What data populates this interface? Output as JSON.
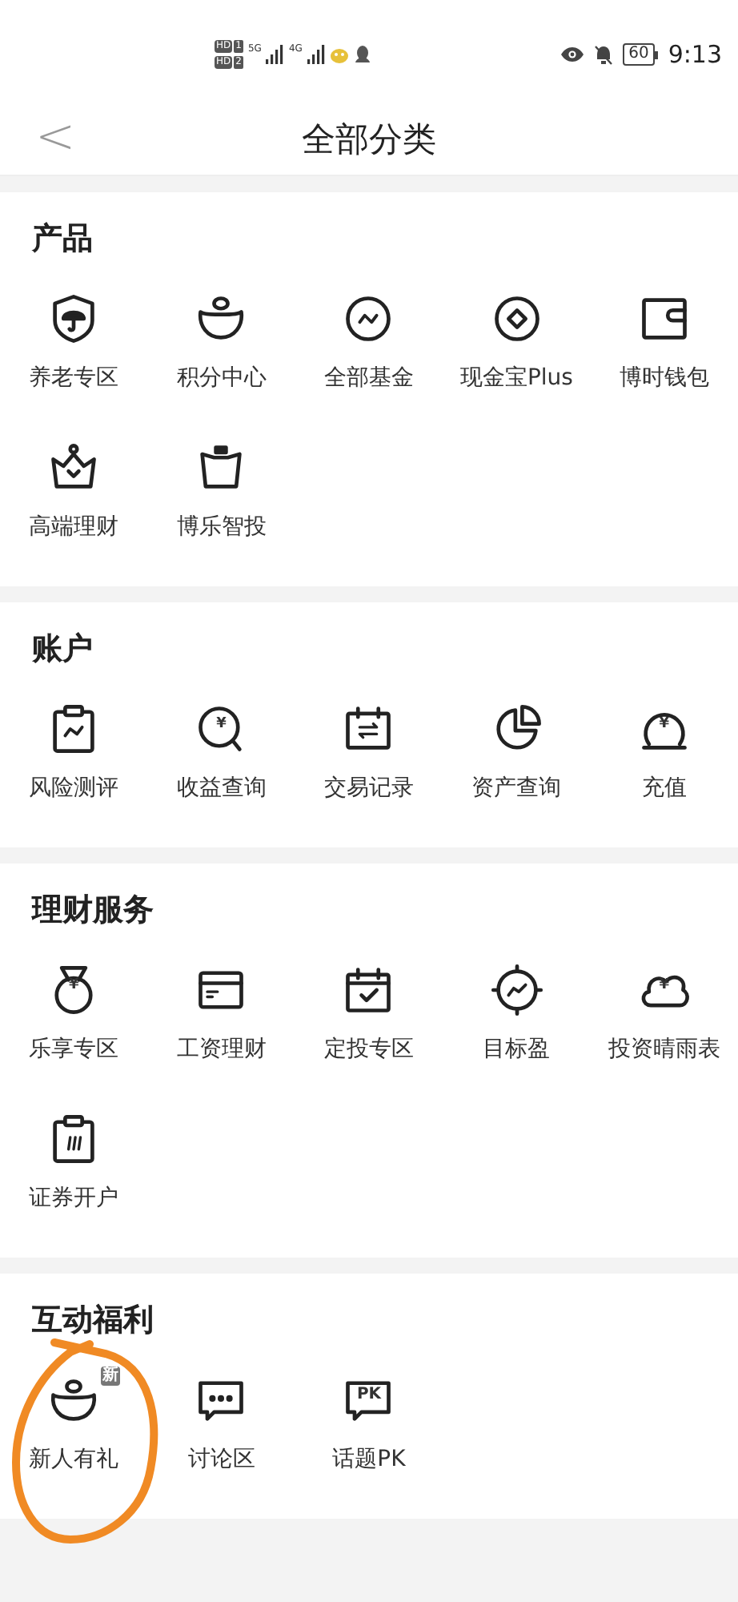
{
  "status_bar": {
    "sims": [
      {
        "badge": "HD",
        "slot": "1"
      },
      {
        "badge": "HD",
        "slot": "2"
      }
    ],
    "networks": [
      "5G",
      "4G"
    ],
    "battery": "60",
    "time": "9:13"
  },
  "header": {
    "back": "<",
    "title": "全部分类"
  },
  "sections": [
    {
      "title": "产品",
      "items": [
        {
          "label": "养老专区"
        },
        {
          "label": "积分中心"
        },
        {
          "label": "全部基金"
        },
        {
          "label": "现金宝Plus"
        },
        {
          "label": "博时钱包"
        },
        {
          "label": "高端理财"
        },
        {
          "label": "博乐智投"
        }
      ]
    },
    {
      "title": "账户",
      "items": [
        {
          "label": "风险测评"
        },
        {
          "label": "收益查询",
          "icon_text": "¥"
        },
        {
          "label": "交易记录"
        },
        {
          "label": "资产查询"
        },
        {
          "label": "充值",
          "icon_text": "¥"
        }
      ]
    },
    {
      "title": "理财服务",
      "items": [
        {
          "label": "乐享专区",
          "icon_text": "¥"
        },
        {
          "label": "工资理财"
        },
        {
          "label": "定投专区"
        },
        {
          "label": "目标盈"
        },
        {
          "label": "投资晴雨表",
          "icon_text": "¥"
        },
        {
          "label": "证券开户"
        }
      ]
    },
    {
      "title": "互动福利",
      "items": [
        {
          "label": "新人有礼",
          "badge": "新",
          "highlighted": true
        },
        {
          "label": "讨论区"
        },
        {
          "label": "话题PK",
          "icon_text": "PK"
        }
      ]
    }
  ]
}
